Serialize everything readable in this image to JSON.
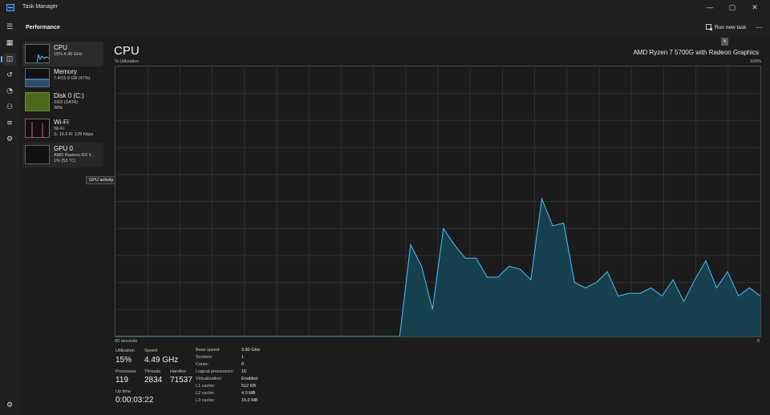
{
  "app": {
    "title": "Task Manager"
  },
  "header": {
    "title": "Performance",
    "run_new_task": "Run new task",
    "more": "..."
  },
  "window_controls": {
    "minimize": "—",
    "maximize": "▢",
    "close": "✕"
  },
  "nav_rail": [
    "menu",
    "processes",
    "performance",
    "app-history",
    "startup-apps",
    "users",
    "details",
    "services",
    "settings"
  ],
  "sidebar": {
    "items": [
      {
        "title": "CPU",
        "sub1": "15% 4.49 GHz",
        "sub2": ""
      },
      {
        "title": "Memory",
        "sub1": "7.4/15.9 GB (47%)",
        "sub2": ""
      },
      {
        "title": "Disk 0 (C:)",
        "sub1": "SSD (SATA)",
        "sub2": "30%"
      },
      {
        "title": "Wi-Fi",
        "sub1": "Wi-Fi",
        "sub2": "S: 16.0 R: 128 Kbps"
      },
      {
        "title": "GPU 0",
        "sub1": "AMD Radeon RX 6...",
        "sub2": "1% (53 °C)"
      }
    ],
    "tooltip": "GPU activity"
  },
  "main": {
    "title": "CPU",
    "cpu_model": "AMD Ryzen 7 5700G with Radeon Graphics",
    "y_label": "% Utilization",
    "y_max": "100%",
    "x_left": "60 seconds",
    "x_right": "0",
    "cursor_glyph": "N"
  },
  "chart_data": {
    "type": "area",
    "x_range_seconds": [
      60,
      0
    ],
    "y_range_percent": [
      0,
      100
    ],
    "series": [
      {
        "values": [
          0,
          0,
          0,
          0,
          0,
          0,
          0,
          0,
          0,
          0,
          0,
          0,
          0,
          0,
          0,
          0,
          0,
          0,
          0,
          0,
          0,
          0,
          0,
          0,
          0,
          0,
          0,
          34,
          26,
          10,
          40,
          34,
          29,
          29,
          22,
          22,
          26,
          25,
          21,
          51,
          41,
          42,
          20,
          18,
          20,
          24,
          15,
          16,
          16,
          18,
          15,
          21,
          13,
          21,
          28,
          18,
          24,
          15,
          18,
          15
        ]
      }
    ],
    "color": "#4cc2ff"
  },
  "stats": {
    "utilization": {
      "label": "Utilization",
      "value": "15%"
    },
    "speed": {
      "label": "Speed",
      "value": "4.49 GHz"
    },
    "processes": {
      "label": "Processes",
      "value": "119"
    },
    "threads": {
      "label": "Threads",
      "value": "2834"
    },
    "handles": {
      "label": "Handles",
      "value": "71537"
    },
    "uptime": {
      "label": "Up time",
      "value": "0:00:03:22"
    }
  },
  "specs": [
    {
      "label": "Base speed:",
      "value": "3.80 GHz"
    },
    {
      "label": "Sockets:",
      "value": "1"
    },
    {
      "label": "Cores:",
      "value": "8"
    },
    {
      "label": "Logical processors:",
      "value": "16"
    },
    {
      "label": "Virtualization:",
      "value": "Enabled"
    },
    {
      "label": "L1 cache:",
      "value": "512 KB"
    },
    {
      "label": "L2 cache:",
      "value": "4.0 MB"
    },
    {
      "label": "L3 cache:",
      "value": "16.0 MB"
    }
  ]
}
